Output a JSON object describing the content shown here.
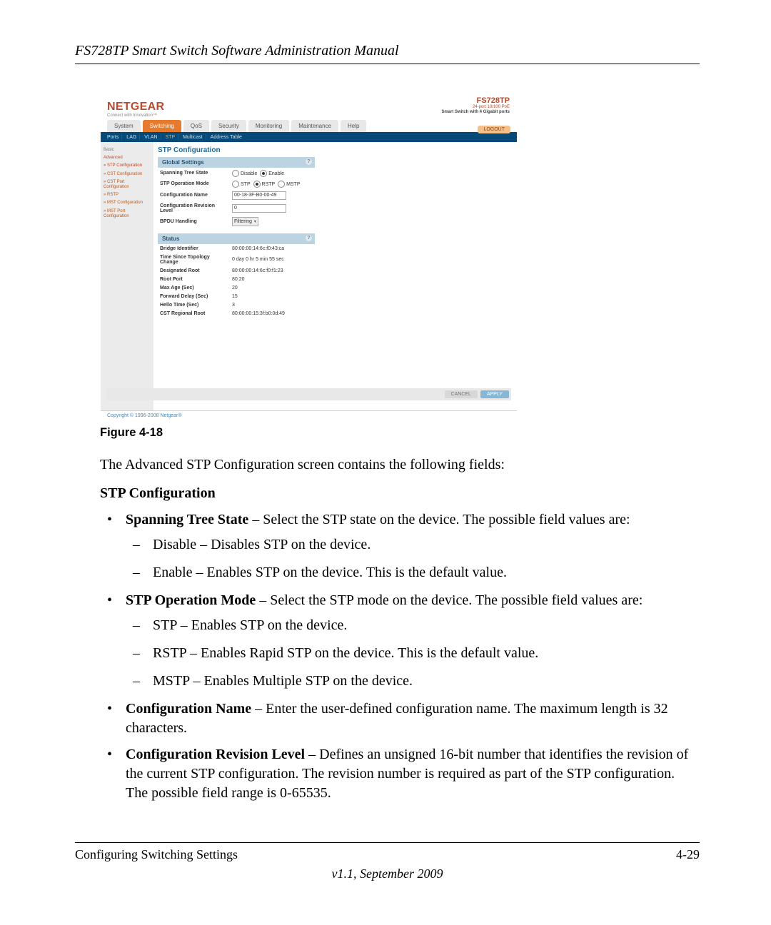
{
  "header": {
    "title": "FS728TP Smart Switch Software Administration Manual"
  },
  "screenshot": {
    "brand": "NETGEAR",
    "brand_tag": "Connect with Innovation™",
    "model": {
      "name": "FS728TP",
      "desc": "24-port 10/100 PoE",
      "sub": "Smart Switch with 4 Gigabit ports"
    },
    "tabs": [
      "System",
      "Switching",
      "QoS",
      "Security",
      "Monitoring",
      "Maintenance",
      "Help"
    ],
    "active_tab": "Switching",
    "logout": "LOGOUT",
    "subtabs": [
      "Ports",
      "LAG",
      "VLAN",
      "STP",
      "Multicast",
      "Address Table"
    ],
    "active_subtab": "STP",
    "sidebar": {
      "items": [
        {
          "label": "Basic",
          "cls": "gray"
        },
        {
          "label": "Advanced",
          "cls": "active"
        },
        {
          "label": "» STP Configuration",
          "cls": "active"
        },
        {
          "label": "» CST Configuration",
          "cls": ""
        },
        {
          "label": "» CST Port Configuration",
          "cls": ""
        },
        {
          "label": "» RSTP",
          "cls": ""
        },
        {
          "label": "» MST Configuration",
          "cls": ""
        },
        {
          "label": "» MST Port Configuration",
          "cls": ""
        }
      ]
    },
    "page_title": "STP Configuration",
    "global": {
      "header": "Global Settings",
      "rows": {
        "spanning_tree_state": {
          "label": "Spanning Tree State",
          "opt1": "Disable",
          "opt2": "Enable"
        },
        "stp_op_mode": {
          "label": "STP Operation Mode",
          "opt1": "STP",
          "opt2": "RSTP",
          "opt3": "MSTP"
        },
        "config_name": {
          "label": "Configuration Name",
          "value": "00-18-3F-B0-00-49"
        },
        "config_rev": {
          "label": "Configuration Revision Level",
          "value": "0"
        },
        "bpdu": {
          "label": "BPDU Handling",
          "value": "Filtering"
        }
      }
    },
    "status": {
      "header": "Status",
      "rows": [
        {
          "label": "Bridge Identifier",
          "value": "80:00:00:14:6c:f0:43:ca"
        },
        {
          "label": "Time Since Topology Change",
          "value": "0 day 0 hr 5 min 55 sec"
        },
        {
          "label": "Designated Root",
          "value": "80:00:00:14:6c:f0:f1:23"
        },
        {
          "label": "Root Port",
          "value": "80:20"
        },
        {
          "label": "Max Age (Sec)",
          "value": "20"
        },
        {
          "label": "Forward Delay (Sec)",
          "value": "15"
        },
        {
          "label": "Hello Time (Sec)",
          "value": "3"
        },
        {
          "label": "CST Regional Root",
          "value": "80:00:00:15:3f:b0:0d:49"
        }
      ]
    },
    "footer_buttons": {
      "cancel": "CANCEL",
      "apply": "APPLY"
    },
    "copyright": "Copyright © 1996-2008 Netgear®"
  },
  "figure_label": "Figure 4-18",
  "intro_text": "The Advanced STP Configuration screen contains the following fields:",
  "section_title": "STP Configuration",
  "bullets": [
    {
      "lead": "Spanning Tree State",
      "rest": " – Select the STP state on the device. The possible field values are:",
      "subs": [
        "Disable – Disables STP on the device.",
        "Enable – Enables STP on the device. This is the default value."
      ]
    },
    {
      "lead": "STP Operation Mode",
      "rest": " – Select the STP mode on the device. The possible field values are:",
      "subs": [
        "STP – Enables STP on the device.",
        "RSTP – Enables Rapid STP on the device. This is the default value.",
        "MSTP – Enables Multiple STP on the device."
      ]
    },
    {
      "lead": "Configuration Name",
      "rest": " – Enter the user-defined configuration name. The maximum length is 32 characters.",
      "subs": []
    },
    {
      "lead": "Configuration Revision Level",
      "rest": " – Defines an unsigned 16-bit number that identifies the revision of the current STP configuration. The revision number is required as part of the STP configuration. The possible field range is 0-65535.",
      "subs": []
    }
  ],
  "footer": {
    "left": "Configuring Switching Settings",
    "right": "4-29",
    "version": "v1.1, September 2009"
  }
}
